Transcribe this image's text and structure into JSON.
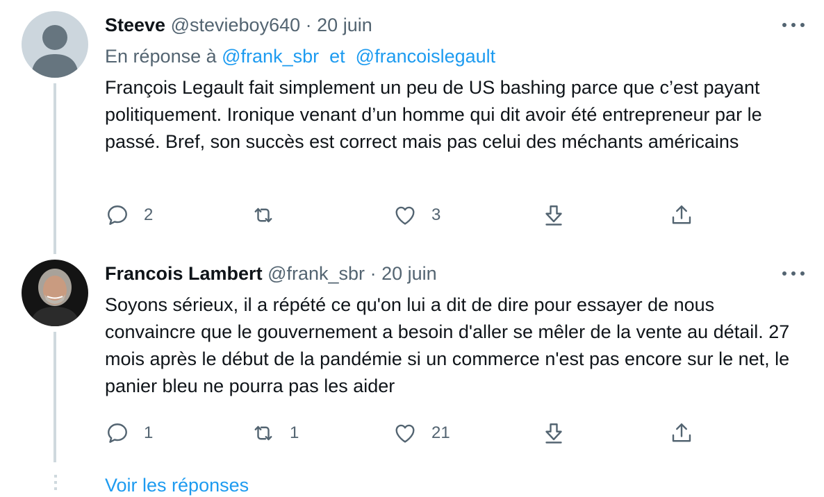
{
  "colors": {
    "link": "#1d9bf0",
    "secondary": "#536471",
    "text": "#0f1419",
    "thread_line": "#cfd9de"
  },
  "tweets": [
    {
      "name": "Steeve",
      "handle": "@stevieboy640",
      "separator": "·",
      "date": "20 juin",
      "reply_to": {
        "prefix": "En réponse à",
        "mention1": "@frank_sbr",
        "connector": "et",
        "mention2": "@francoislegault"
      },
      "text": "François Legault fait simplement un peu de US bashing parce que c’est payant politiquement. Ironique venant d’un homme qui dit avoir été entrepreneur par le passé. Bref, son succès est correct mais pas celui des méchants américains",
      "replies": "2",
      "retweets": "",
      "likes": "3"
    },
    {
      "name": "Francois Lambert",
      "handle": "@frank_sbr",
      "separator": "·",
      "date": "20 juin",
      "text": "Soyons sérieux, il a répété ce qu'on lui a dit de dire pour essayer de nous convaincre que le gouvernement a besoin d'aller se mêler de la vente au détail. 27 mois après le début de la pandémie si un commerce n'est pas encore sur le net, le panier bleu ne pourra pas les aider",
      "replies": "1",
      "retweets": "1",
      "likes": "21"
    }
  ],
  "show_replies": "Voir les réponses"
}
